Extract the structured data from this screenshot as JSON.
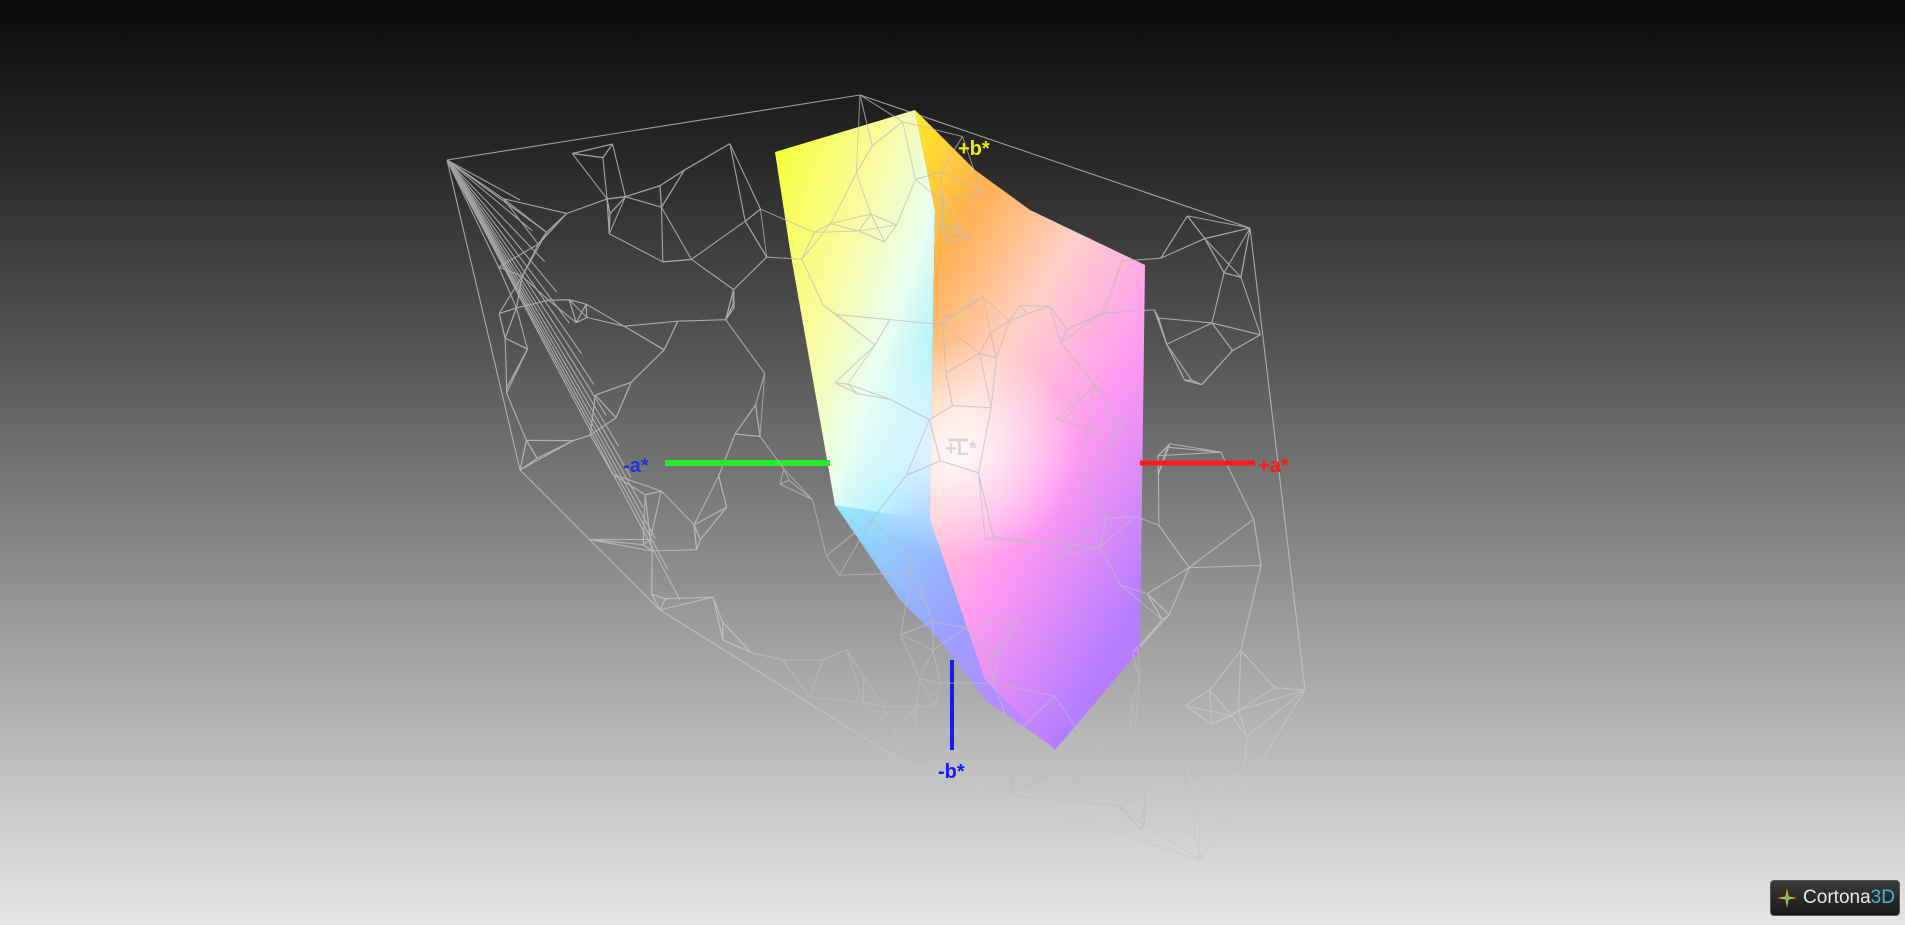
{
  "viewer": {
    "brand_name": "Cortona",
    "brand_suffix": "3D"
  },
  "axes": {
    "pos_a": "+a*",
    "neg_a": "-a*",
    "pos_b": "+b*",
    "neg_b": "-b*",
    "pos_L": "+L*",
    "colors": {
      "a_pos": "#ff1a1a",
      "a_neg": "#22ee22",
      "b_neg": "#1a1aee",
      "b_pos": "#eeee00",
      "L": "#d8d8d8",
      "neg_a_label": "#2233dd"
    }
  },
  "icons": {
    "brand_logo": "cortona-star-icon"
  }
}
